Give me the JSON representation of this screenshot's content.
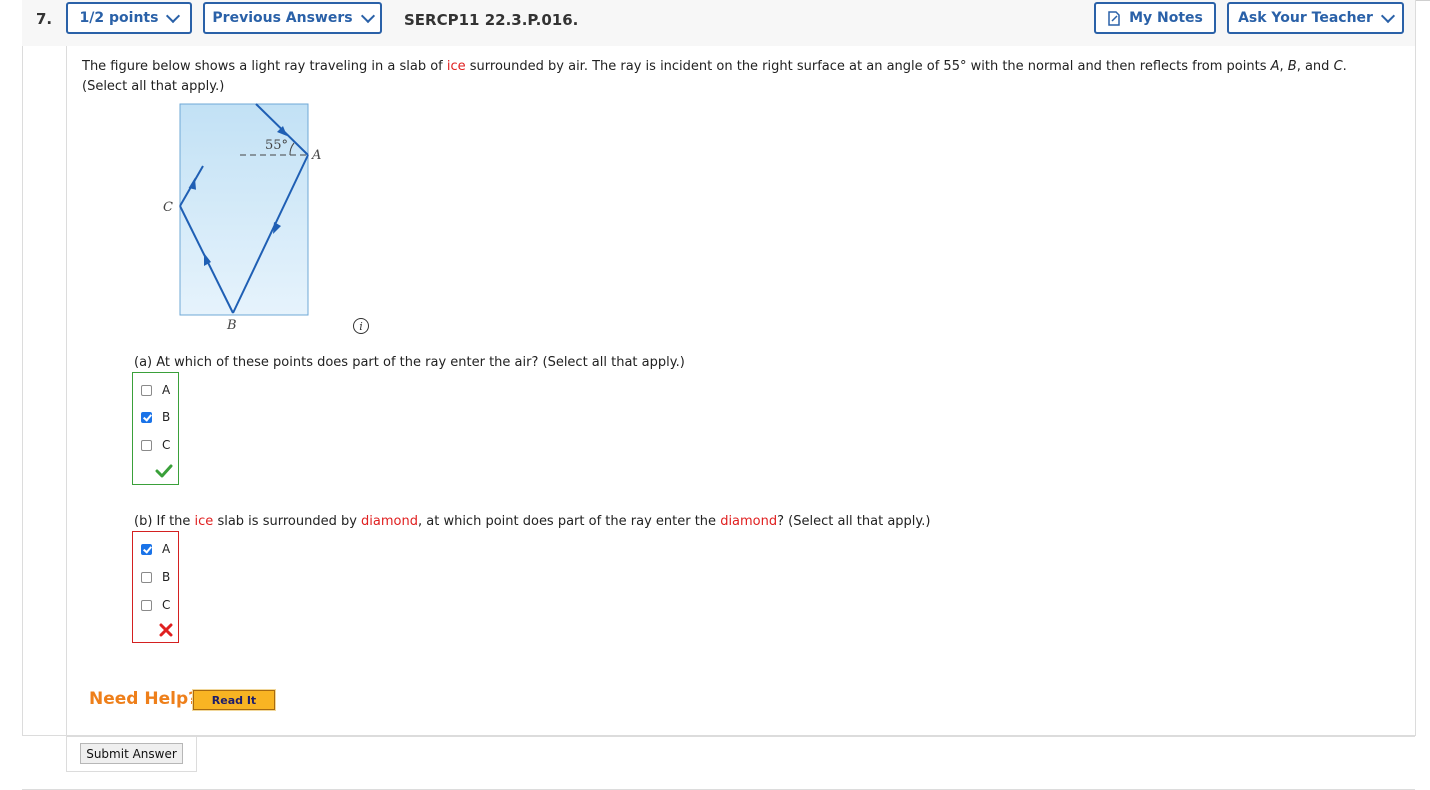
{
  "question": {
    "number": "7.",
    "points_label": "1/2 points",
    "previous_answers_label": "Previous Answers",
    "code": "SERCP11 22.3.P.016.",
    "my_notes_label": "My Notes",
    "ask_teacher_label": "Ask Your Teacher"
  },
  "prompt": {
    "part1": "The figure below shows a light ray traveling in a slab of ",
    "ice": "ice",
    "part2": " surrounded by air. The ray is incident on the right surface at an angle of 55° with the normal and then reflects from points ",
    "A": "A",
    "sep1": ", ",
    "B": "B",
    "sep2": ", and ",
    "C": "C",
    "end": ".",
    "line2": "(Select all that apply.)"
  },
  "figure": {
    "angle_label": "55°",
    "label_a": "A",
    "label_b": "B",
    "label_c": "C",
    "info_icon_text": "i"
  },
  "part_a": {
    "text": "(a) At which of these points does part of the ray enter the air? (Select all that apply.)",
    "options": [
      {
        "label": "A",
        "checked": false
      },
      {
        "label": "B",
        "checked": true
      },
      {
        "label": "C",
        "checked": false
      }
    ],
    "result": "correct",
    "box_color": "#3aa03a"
  },
  "part_b": {
    "t1": "(b) If the ",
    "ice": "ice",
    "t2": " slab is surrounded by ",
    "diamond1": "diamond",
    "t3": ", at which point does part of the ray enter the ",
    "diamond2": "diamond",
    "t4": "? (Select all that apply.)",
    "options": [
      {
        "label": "A",
        "checked": true
      },
      {
        "label": "B",
        "checked": false
      },
      {
        "label": "C",
        "checked": false
      }
    ],
    "result": "incorrect",
    "box_color": "#d42020"
  },
  "help": {
    "need_help": "Need Help?",
    "read_it": "Read It"
  },
  "submit_label": "Submit Answer",
  "colors": {
    "brand_blue": "#2a61a8",
    "ray_blue": "#1f5fb4",
    "ice_fill": "#c9e5f7",
    "highlight_red": "#e02020",
    "help_orange": "#ee7f1a"
  }
}
